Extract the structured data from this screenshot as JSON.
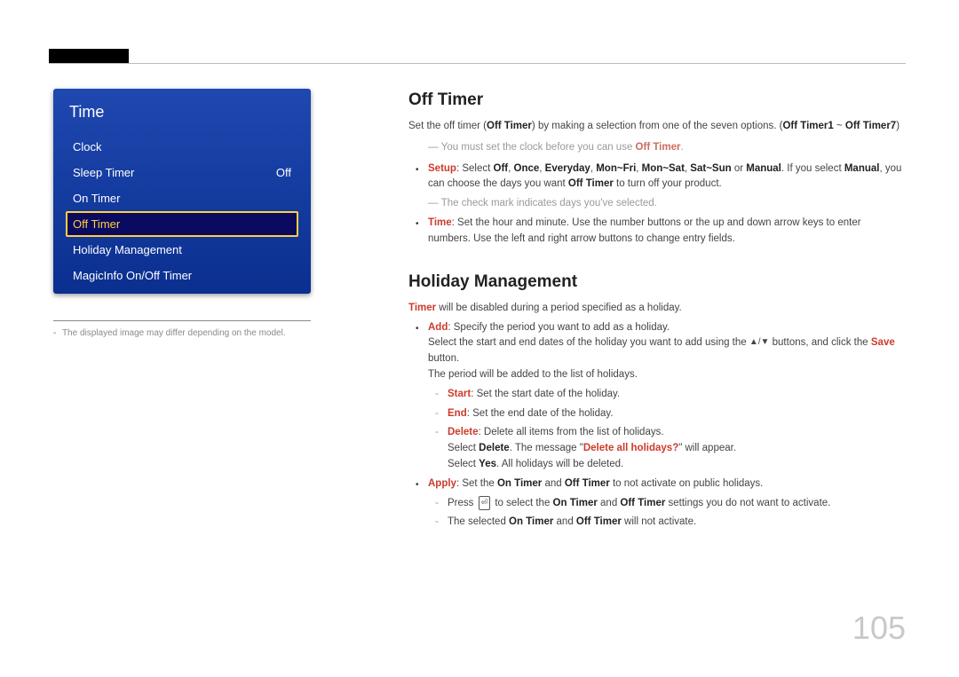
{
  "page_number": "105",
  "menu": {
    "title": "Time",
    "items": [
      {
        "label": "Clock",
        "value": ""
      },
      {
        "label": "Sleep Timer",
        "value": "Off"
      },
      {
        "label": "On Timer",
        "value": ""
      },
      {
        "label": "Off Timer",
        "value": "",
        "selected": true
      },
      {
        "label": "Holiday Management",
        "value": ""
      },
      {
        "label": "MagicInfo On/Off Timer",
        "value": ""
      }
    ]
  },
  "left_footnote": "The displayed image may differ depending on the model.",
  "sections": {
    "off_timer": {
      "heading": "Off Timer",
      "intro_pre": "Set the off timer (",
      "intro_bold1": "Off Timer",
      "intro_mid": ") by making a selection from one of the seven options. (",
      "intro_bold2": "Off Timer1",
      "intro_tilde": " ~ ",
      "intro_bold3": "Off Timer7",
      "intro_post": ")",
      "note1_pre": "You must set the clock before you can use ",
      "note1_bold": "Off Timer",
      "note1_post": ".",
      "setup_label": "Setup",
      "setup_pre": ": Select ",
      "setup_opts": [
        "Off",
        "Once",
        "Everyday",
        "Mon~Fri",
        "Mon~Sat",
        "Sat~Sun",
        "Manual"
      ],
      "setup_or": " or ",
      "setup_post1": ". If you select ",
      "setup_manual": "Manual",
      "setup_post2": ", you can choose the days you want ",
      "setup_offtimer": "Off Timer",
      "setup_post3": " to turn off your product.",
      "note2": "The check mark indicates days you've selected.",
      "time_label": "Time",
      "time_text": ": Set the hour and minute. Use the number buttons or the up and down arrow keys to enter numbers. Use the left and right arrow buttons to change entry fields."
    },
    "holiday": {
      "heading": "Holiday Management",
      "intro_bold": "Timer",
      "intro_post": " will be disabled during a period specified as a holiday.",
      "add_label": "Add",
      "add_text": ": Specify the period you want to add as a holiday.",
      "add_line2_pre": "Select the start and end dates of the holiday you want to add using the ",
      "add_line2_post": " buttons, and click the ",
      "save_label": "Save",
      "add_line2_end": " button.",
      "add_line3": "The period will be added to the list of holidays.",
      "start_label": "Start",
      "start_text": ": Set the start date of the holiday.",
      "end_label": "End",
      "end_text": ": Set the end date of the holiday.",
      "delete_label": "Delete",
      "delete_text": ": Delete all items from the list of holidays.",
      "delete_line2_pre": "Select ",
      "delete_bold": "Delete",
      "delete_line2_mid": ". The message \"",
      "delete_msg": "Delete all holidays?",
      "delete_line2_post": "\" will appear.",
      "delete_line3_pre": "Select ",
      "yes_bold": "Yes",
      "delete_line3_post": ". All holidays will be deleted.",
      "apply_label": "Apply",
      "apply_pre": ": Set the ",
      "apply_on": "On Timer",
      "apply_and": " and ",
      "apply_off": "Off Timer",
      "apply_post": " to not activate on public holidays.",
      "apply_sub1_pre": "Press ",
      "apply_sub1_mid": " to select the ",
      "apply_sub1_post": " settings you do not want to activate.",
      "apply_sub2_pre": "The selected ",
      "apply_sub2_post": " will not activate."
    }
  }
}
